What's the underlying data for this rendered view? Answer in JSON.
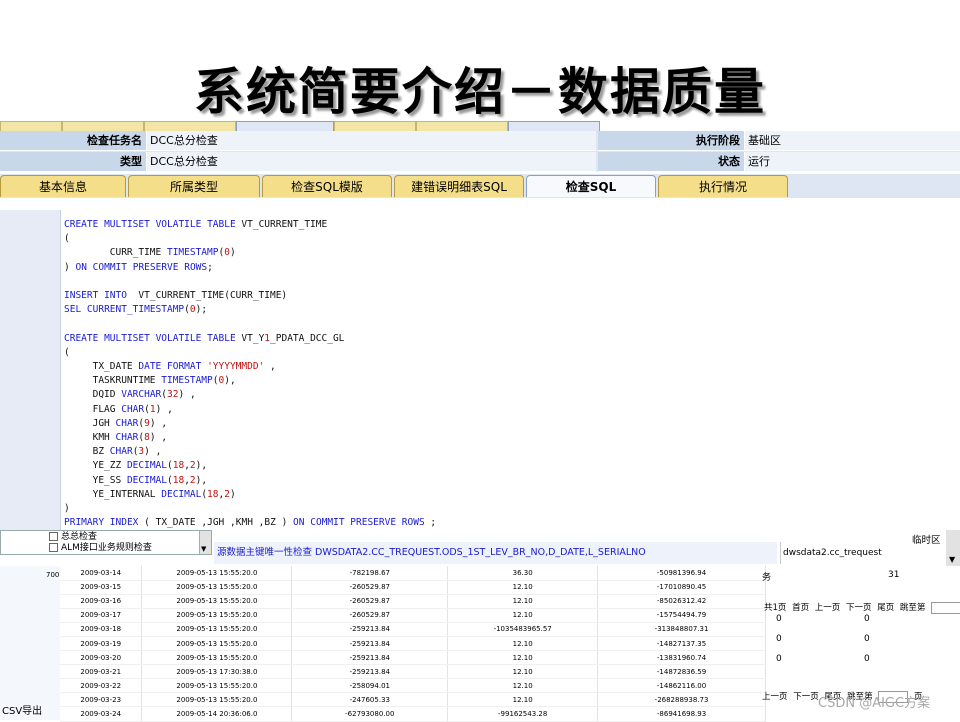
{
  "slide": {
    "title": "系统简要介绍－数据质量"
  },
  "info": {
    "task_label": "检查任务名",
    "task_value": "DCC总分检查",
    "type_label": "类型",
    "type_value": "DCC总分检查",
    "stage_label": "执行阶段",
    "stage_value": "基础区",
    "status_label": "状态",
    "status_value": "运行"
  },
  "tabs": [
    {
      "label": "基本信息"
    },
    {
      "label": "所属类型"
    },
    {
      "label": "检查SQL模版"
    },
    {
      "label": "建错误明细表SQL"
    },
    {
      "label": "检查SQL"
    },
    {
      "label": "执行情况"
    }
  ],
  "tree": {
    "items": [
      "总总检查",
      "ALM接口业务规则检查"
    ]
  },
  "rule": {
    "text": "源数据主键唯一性检查  DWSDATA2.CC_TREQUEST.ODS_1ST_LEV_BR_NO,D_DATE,L_SERIALNO",
    "table": "dwsdata2.cc_trequest",
    "side": "临时区"
  },
  "left": {
    "num": "700",
    "csv": "CSV导出"
  },
  "rows": [
    [
      "2009-03-14",
      "2009-05-13 15:55:20.0",
      "-782198.67",
      "36.30",
      "-50981396.94"
    ],
    [
      "2009-03-15",
      "2009-05-13 15:55:20.0",
      "-260529.87",
      "12.10",
      "-17010890.45"
    ],
    [
      "2009-03-16",
      "2009-05-13 15:55:20.0",
      "-260529.87",
      "12.10",
      "-85026312.42"
    ],
    [
      "2009-03-17",
      "2009-05-13 15:55:20.0",
      "-260529.87",
      "12.10",
      "-15754494.79"
    ],
    [
      "2009-03-18",
      "2009-05-13 15:55:20.0",
      "-259213.84",
      "-1035483965.57",
      "-313848807.31"
    ],
    [
      "2009-03-19",
      "2009-05-13 15:55:20.0",
      "-259213.84",
      "12.10",
      "-14827137.35"
    ],
    [
      "2009-03-20",
      "2009-05-13 15:55:20.0",
      "-259213.84",
      "12.10",
      "-13831960.74"
    ],
    [
      "2009-03-21",
      "2009-05-13 17:30:38.0",
      "-259213.84",
      "12.10",
      "-14872836.59"
    ],
    [
      "2009-03-22",
      "2009-05-13 15:55:20.0",
      "-258094.01",
      "12.10",
      "-14862116.00"
    ],
    [
      "2009-03-23",
      "2009-05-13 15:55:20.0",
      "-247605.33",
      "12.10",
      "-268288938.73"
    ],
    [
      "2009-03-24",
      "2009-05-14 20:36:06.0",
      "-62793080.00",
      "-99162543.28",
      "-86941698.93"
    ]
  ],
  "right_panel": {
    "task_tail": "务",
    "count": "31",
    "pager_top": "共1页 首页 上一页 下一页 尾页 跳至第",
    "pager_unit": "页",
    "zeros": [
      "0",
      "0",
      "0",
      "0",
      "0",
      "0"
    ],
    "pager_bottom": "上一页 下一页 尾页 跳至第",
    "pager_bottom_unit": "页"
  },
  "watermark": "CSDN @AIGC方案",
  "sql_lines": [
    "CREATE MULTISET VOLATILE TABLE VT_CURRENT_TIME",
    "(",
    "        CURR_TIME TIMESTAMP(0)",
    ") ON COMMIT PRESERVE ROWS;",
    "",
    "INSERT INTO  VT_CURRENT_TIME(CURR_TIME)",
    "SEL CURRENT_TIMESTAMP(0);",
    "",
    "CREATE MULTISET VOLATILE TABLE VT_Y1_PDATA_DCC_GL",
    "(",
    "     TX_DATE DATE FORMAT 'YYYYMMDD' ,",
    "     TASKRUNTIME TIMESTAMP(0),",
    "     DQID VARCHAR(32) ,",
    "     FLAG CHAR(1) ,",
    "     JGH CHAR(9) ,",
    "     KMH CHAR(8) ,",
    "     BZ CHAR(3) ,",
    "     YE_ZZ DECIMAL(18,2),",
    "     YE_SS DECIMAL(18,2),",
    "     YE_INTERNAL DECIMAL(18,2)",
    ")",
    "PRIMARY INDEX ( TX_DATE ,JGH ,KMH ,BZ ) ON COMMIT PRESERVE ROWS ;"
  ],
  "colors": {
    "keyword": "#1a1ad0",
    "literal": "#c01010",
    "tab_fill": "#f5de8a",
    "header_fill": "#dde6f2"
  }
}
